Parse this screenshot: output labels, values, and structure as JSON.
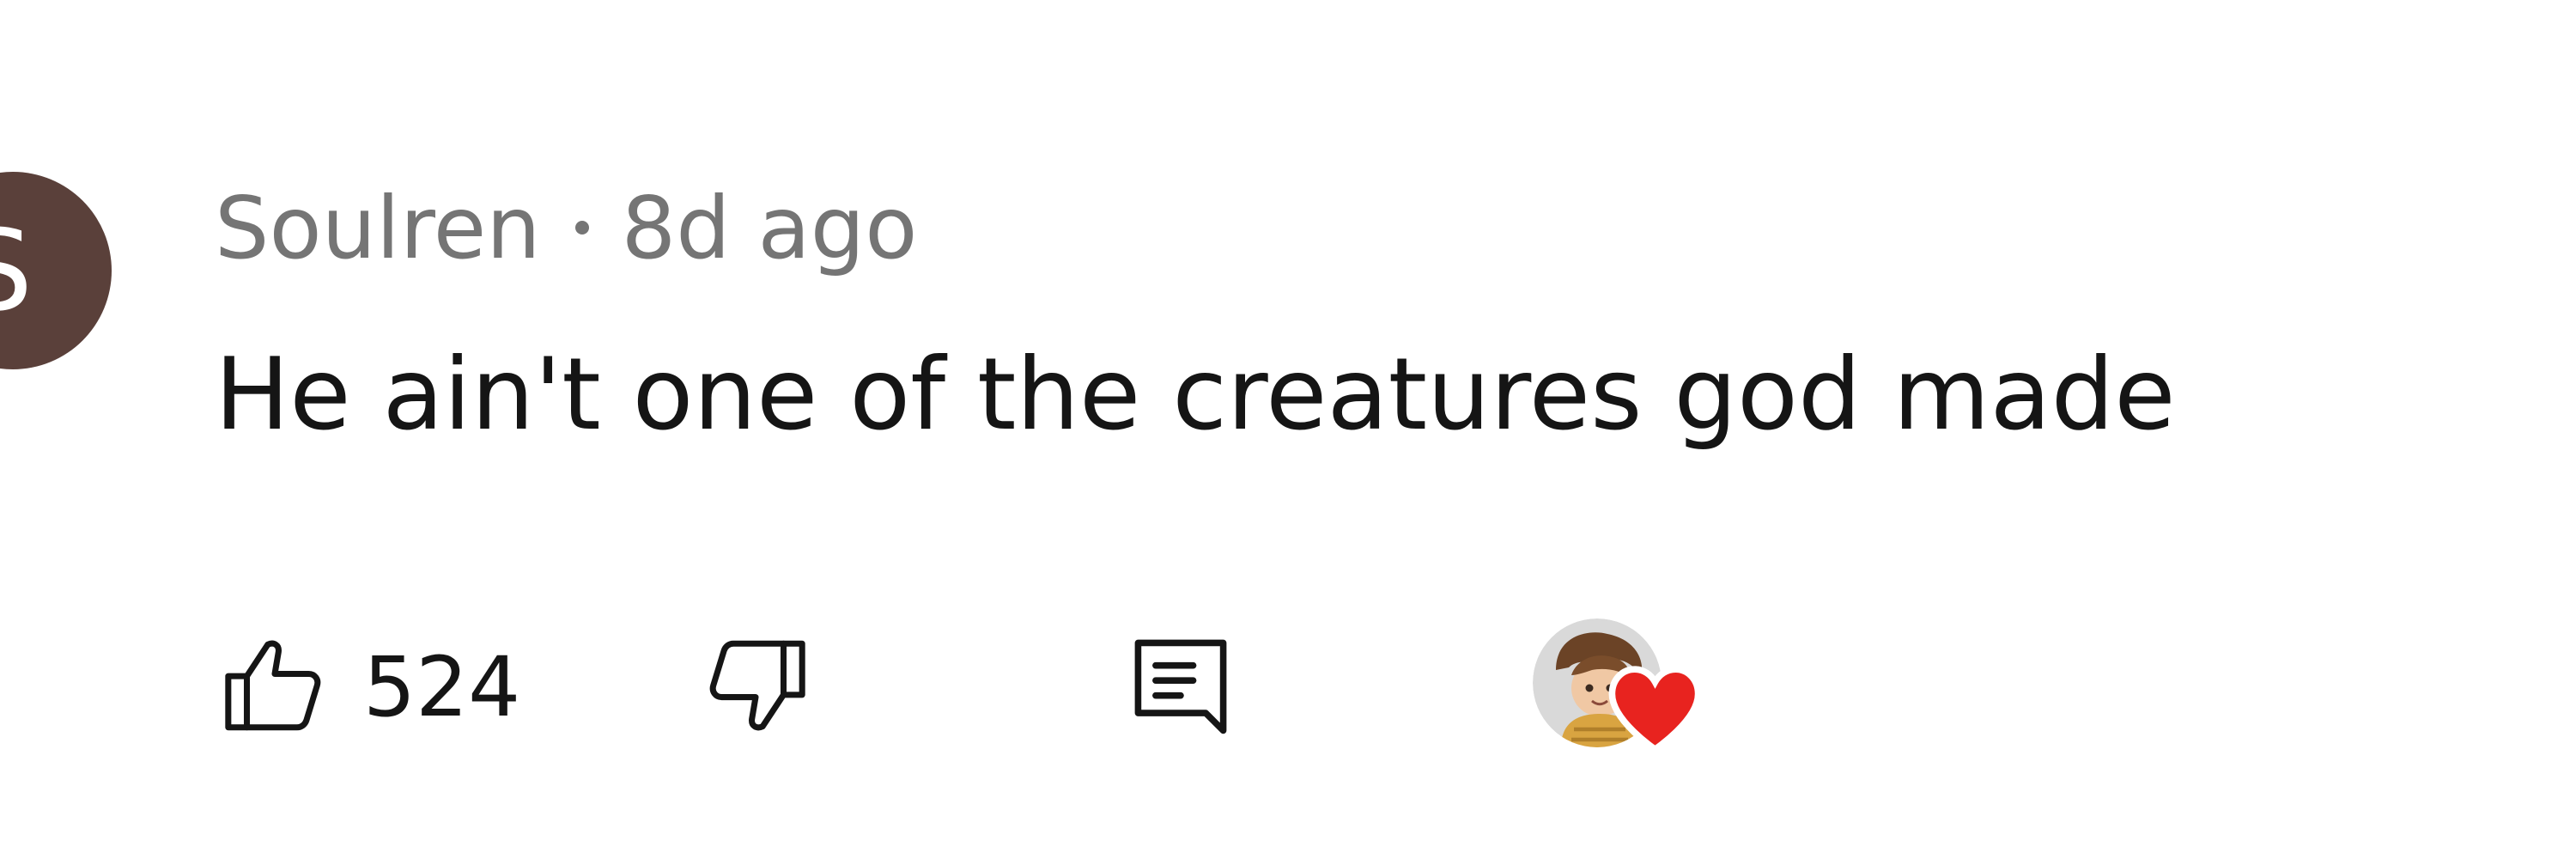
{
  "comment": {
    "avatar_letter": "S",
    "avatar_color": "#5a403a",
    "author": "Soulren",
    "separator": "•",
    "time": "8d ago",
    "text": "He ain't one of the creatures god made"
  },
  "actions": {
    "like_icon": "thumbs-up-icon",
    "like_count": "524",
    "dislike_icon": "thumbs-down-icon",
    "reply_icon": "reply-comment-icon",
    "creator_heart": {
      "avatar_icon": "creator-avatar-icon",
      "heart_icon": "heart-icon",
      "heart_color": "#e8231f"
    }
  }
}
